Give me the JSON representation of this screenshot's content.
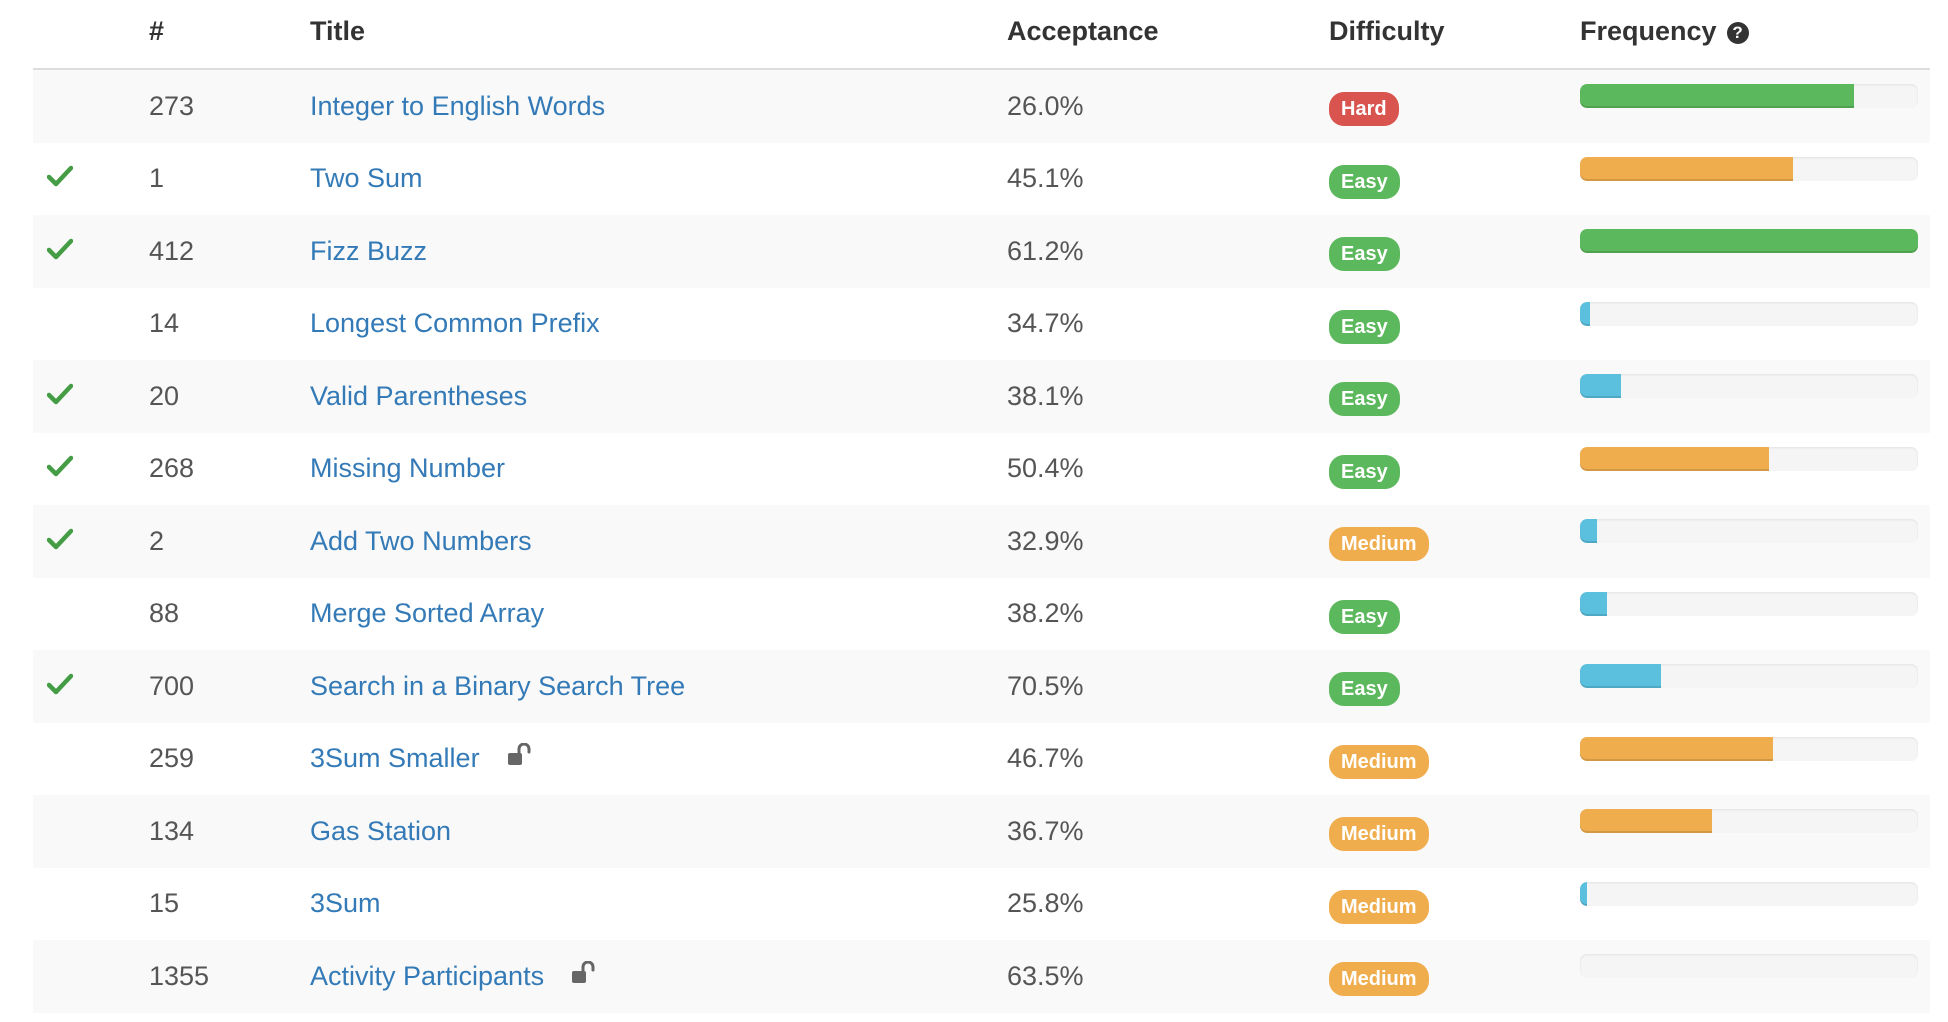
{
  "header": {
    "num": "#",
    "title": "Title",
    "acceptance": "Acceptance",
    "difficulty": "Difficulty",
    "frequency": "Frequency",
    "frequency_help_icon": "question-circle-icon"
  },
  "colors": {
    "link": "#337ab7",
    "easy": "#5cb85c",
    "medium": "#f0ad4e",
    "hard": "#d9534f",
    "freq_green": "#5cb85c",
    "freq_orange": "#f0ad4e",
    "freq_blue": "#5bc0de",
    "check": "#449d44"
  },
  "rows": [
    {
      "solved": false,
      "num": "273",
      "title": "Integer to English Words",
      "locked": false,
      "acceptance": "26.0%",
      "difficulty": "Hard",
      "difficulty_level": "hard",
      "frequency": 0.81,
      "freq_color": "green"
    },
    {
      "solved": true,
      "num": "1",
      "title": "Two Sum",
      "locked": false,
      "acceptance": "45.1%",
      "difficulty": "Easy",
      "difficulty_level": "easy",
      "frequency": 0.63,
      "freq_color": "orange"
    },
    {
      "solved": true,
      "num": "412",
      "title": "Fizz Buzz",
      "locked": false,
      "acceptance": "61.2%",
      "difficulty": "Easy",
      "difficulty_level": "easy",
      "frequency": 1.0,
      "freq_color": "green"
    },
    {
      "solved": false,
      "num": "14",
      "title": "Longest Common Prefix",
      "locked": false,
      "acceptance": "34.7%",
      "difficulty": "Easy",
      "difficulty_level": "easy",
      "frequency": 0.03,
      "freq_color": "blue"
    },
    {
      "solved": true,
      "num": "20",
      "title": "Valid Parentheses",
      "locked": false,
      "acceptance": "38.1%",
      "difficulty": "Easy",
      "difficulty_level": "easy",
      "frequency": 0.12,
      "freq_color": "blue"
    },
    {
      "solved": true,
      "num": "268",
      "title": "Missing Number",
      "locked": false,
      "acceptance": "50.4%",
      "difficulty": "Easy",
      "difficulty_level": "easy",
      "frequency": 0.56,
      "freq_color": "orange"
    },
    {
      "solved": true,
      "num": "2",
      "title": "Add Two Numbers",
      "locked": false,
      "acceptance": "32.9%",
      "difficulty": "Medium",
      "difficulty_level": "medium",
      "frequency": 0.05,
      "freq_color": "blue"
    },
    {
      "solved": false,
      "num": "88",
      "title": "Merge Sorted Array",
      "locked": false,
      "acceptance": "38.2%",
      "difficulty": "Easy",
      "difficulty_level": "easy",
      "frequency": 0.08,
      "freq_color": "blue"
    },
    {
      "solved": true,
      "num": "700",
      "title": "Search in a Binary Search Tree",
      "locked": false,
      "acceptance": "70.5%",
      "difficulty": "Easy",
      "difficulty_level": "easy",
      "frequency": 0.24,
      "freq_color": "blue"
    },
    {
      "solved": false,
      "num": "259",
      "title": "3Sum Smaller",
      "locked": true,
      "acceptance": "46.7%",
      "difficulty": "Medium",
      "difficulty_level": "medium",
      "frequency": 0.57,
      "freq_color": "orange"
    },
    {
      "solved": false,
      "num": "134",
      "title": "Gas Station",
      "locked": false,
      "acceptance": "36.7%",
      "difficulty": "Medium",
      "difficulty_level": "medium",
      "frequency": 0.39,
      "freq_color": "orange"
    },
    {
      "solved": false,
      "num": "15",
      "title": "3Sum",
      "locked": false,
      "acceptance": "25.8%",
      "difficulty": "Medium",
      "difficulty_level": "medium",
      "frequency": 0.02,
      "freq_color": "blue"
    },
    {
      "solved": false,
      "num": "1355",
      "title": "Activity Participants",
      "locked": true,
      "acceptance": "63.5%",
      "difficulty": "Medium",
      "difficulty_level": "medium",
      "frequency": 0.0,
      "freq_color": "blue"
    }
  ]
}
